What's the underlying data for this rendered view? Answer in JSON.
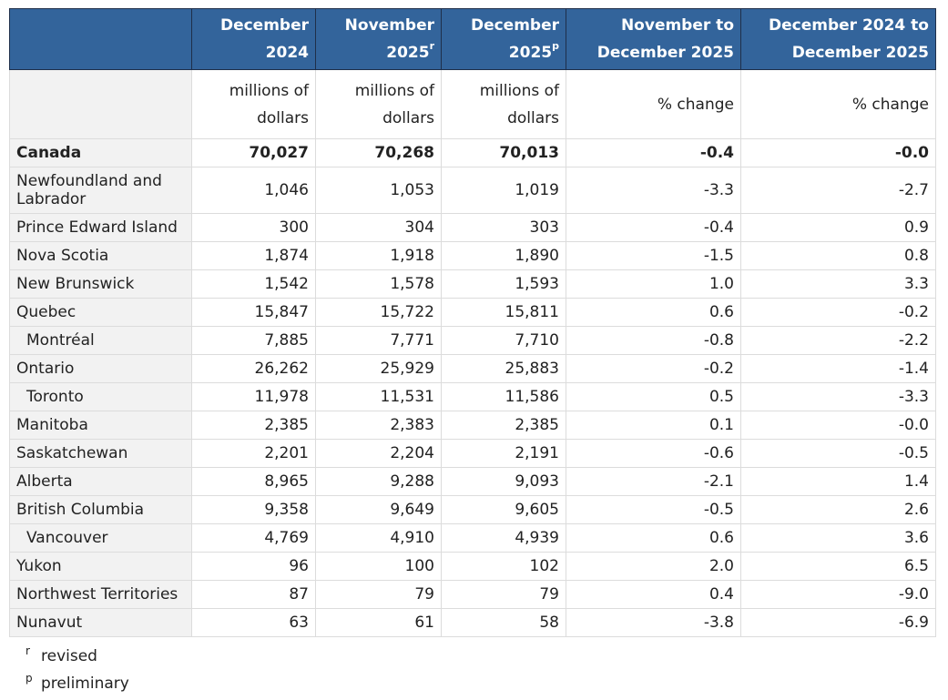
{
  "colors": {
    "header_bg": "#33649b",
    "header_text": "#ffffff",
    "label_bg": "#f2f2f2",
    "border": "#dcdcdc"
  },
  "headers": [
    {
      "line1": "",
      "line2": "",
      "sup": ""
    },
    {
      "line1": "December",
      "line2": "2024",
      "sup": ""
    },
    {
      "line1": "November",
      "line2": "2025",
      "sup": "r"
    },
    {
      "line1": "December",
      "line2": "2025",
      "sup": "p"
    },
    {
      "line1": "November to",
      "line2": "December 2025",
      "sup": ""
    },
    {
      "line1": "December 2024 to",
      "line2": "December 2025",
      "sup": ""
    }
  ],
  "units": [
    {
      "line1": "millions of",
      "line2": "dollars"
    },
    {
      "line1": "millions of",
      "line2": "dollars"
    },
    {
      "line1": "millions of",
      "line2": "dollars"
    },
    {
      "line1": "% change",
      "line2": ""
    },
    {
      "line1": "% change",
      "line2": ""
    }
  ],
  "rows": [
    {
      "label": "Canada",
      "v": [
        "70,027",
        "70,268",
        "70,013",
        "-0.4",
        "-0.0"
      ]
    },
    {
      "label": "Newfoundland and Labrador",
      "v": [
        "1,046",
        "1,053",
        "1,019",
        "-3.3",
        "-2.7"
      ]
    },
    {
      "label": "Prince Edward Island",
      "v": [
        "300",
        "304",
        "303",
        "-0.4",
        "0.9"
      ]
    },
    {
      "label": "Nova Scotia",
      "v": [
        "1,874",
        "1,918",
        "1,890",
        "-1.5",
        "0.8"
      ]
    },
    {
      "label": "New Brunswick",
      "v": [
        "1,542",
        "1,578",
        "1,593",
        "1.0",
        "3.3"
      ]
    },
    {
      "label": "Quebec",
      "v": [
        "15,847",
        "15,722",
        "15,811",
        "0.6",
        "-0.2"
      ]
    },
    {
      "label": "Montréal",
      "v": [
        "7,885",
        "7,771",
        "7,710",
        "-0.8",
        "-2.2"
      ]
    },
    {
      "label": "Ontario",
      "v": [
        "26,262",
        "25,929",
        "25,883",
        "-0.2",
        "-1.4"
      ]
    },
    {
      "label": "Toronto",
      "v": [
        "11,978",
        "11,531",
        "11,586",
        "0.5",
        "-3.3"
      ]
    },
    {
      "label": "Manitoba",
      "v": [
        "2,385",
        "2,383",
        "2,385",
        "0.1",
        "-0.0"
      ]
    },
    {
      "label": "Saskatchewan",
      "v": [
        "2,201",
        "2,204",
        "2,191",
        "-0.6",
        "-0.5"
      ]
    },
    {
      "label": "Alberta",
      "v": [
        "8,965",
        "9,288",
        "9,093",
        "-2.1",
        "1.4"
      ]
    },
    {
      "label": "British Columbia",
      "v": [
        "9,358",
        "9,649",
        "9,605",
        "-0.5",
        "2.6"
      ]
    },
    {
      "label": "Vancouver",
      "v": [
        "4,769",
        "4,910",
        "4,939",
        "0.6",
        "3.6"
      ]
    },
    {
      "label": "Yukon",
      "v": [
        "96",
        "100",
        "102",
        "2.0",
        "6.5"
      ]
    },
    {
      "label": "Northwest Territories",
      "v": [
        "87",
        "79",
        "79",
        "0.4",
        "-9.0"
      ]
    },
    {
      "label": "Nunavut",
      "v": [
        "63",
        "61",
        "58",
        "-3.8",
        "-6.9"
      ]
    }
  ],
  "notes": [
    {
      "symbol": "r",
      "text": "revised"
    },
    {
      "symbol": "p",
      "text": "preliminary"
    }
  ]
}
